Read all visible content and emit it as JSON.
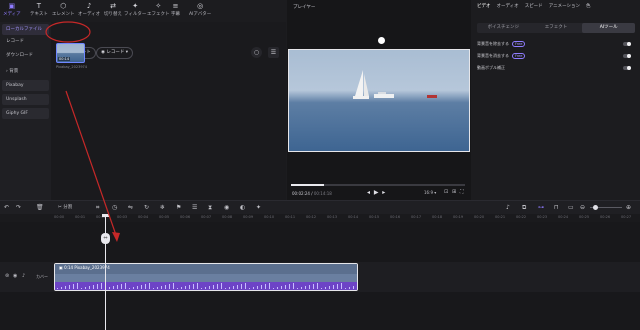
{
  "toolbar": {
    "items": [
      {
        "label": "メディア",
        "icon": "media-icon"
      },
      {
        "label": "テキスト",
        "icon": "text-icon"
      },
      {
        "label": "エレメント",
        "icon": "element-icon"
      },
      {
        "label": "オーディオ",
        "icon": "audio-icon"
      },
      {
        "label": "切り替え",
        "icon": "transition-icon"
      },
      {
        "label": "フィルター",
        "icon": "filter-icon"
      },
      {
        "label": "エフェクト",
        "icon": "effect-icon"
      },
      {
        "label": "字幕",
        "icon": "caption-icon"
      },
      {
        "label": "AIアバター",
        "icon": "ai-avatar-icon"
      }
    ],
    "glyphs": [
      "▣",
      "T",
      "⬡",
      "♪",
      "⇄",
      "✦",
      "✧",
      "≡",
      "◎"
    ]
  },
  "sidebar": {
    "items": [
      {
        "label": "ローカルファイル"
      },
      {
        "label": "レコード"
      },
      {
        "label": "ダウンロード"
      },
      {
        "label": "› 背景"
      },
      {
        "label": "Pixabay"
      },
      {
        "label": "Unsplash"
      },
      {
        "label": "Giphy GIF"
      }
    ]
  },
  "media": {
    "import_label": "インポート",
    "record_label": "レコード",
    "thumb_duration": "00:14",
    "thumb_name": "Pixabay_2023974"
  },
  "player": {
    "title": "プレイヤー",
    "current_time": "00:02:24",
    "total_time": "00:14:18",
    "ratio": "16:9",
    "progress": 0.19
  },
  "props": {
    "tabs": [
      "ビデオ",
      "オーディオ",
      "スピード",
      "アニメーション",
      "色"
    ],
    "subtabs": [
      "ボイスチェンジ",
      "エフェクト",
      "AIツール"
    ],
    "rows": [
      {
        "label": "背景音を除去する",
        "badge": "Free"
      },
      {
        "label": "背景音を消去する",
        "badge": "Free"
      },
      {
        "label": "動画ボブル補正",
        "badge": ""
      }
    ]
  },
  "timeline": {
    "split_label": "分割",
    "ticks": [
      "00:00",
      "00:01",
      "00:02",
      "00:03",
      "00:04",
      "00:05",
      "00:06",
      "00:07",
      "00:08",
      "00:09",
      "00:10",
      "00:11",
      "00:12",
      "00:13",
      "00:14",
      "00:15",
      "00:16",
      "00:17",
      "00:18",
      "00:19",
      "00:20",
      "00:21",
      "00:22",
      "00:23",
      "00:24",
      "00:25",
      "00:26",
      "00:27",
      "00:28",
      "00:29"
    ],
    "track_label": "カバー",
    "clip_label": "0:14 Pixabay_2023974"
  },
  "colors": {
    "accent": "#8f7cff",
    "annotation": "#c62828",
    "clip_top": "#5b6f8e",
    "clip_bottom": "#6d44c6"
  }
}
